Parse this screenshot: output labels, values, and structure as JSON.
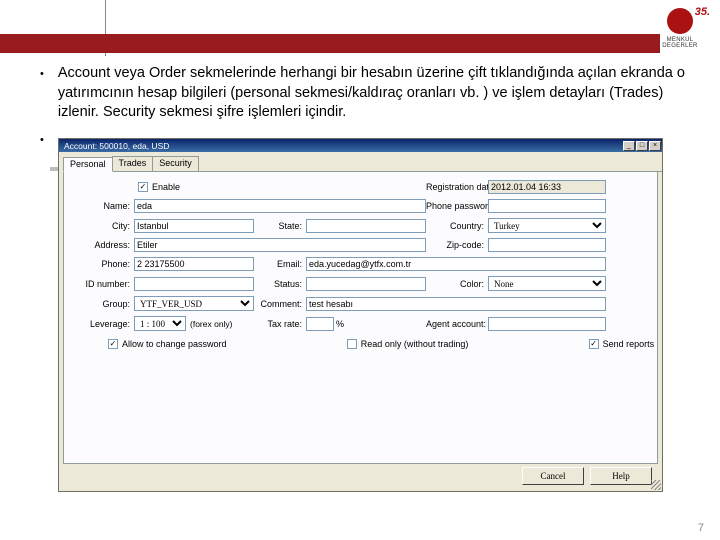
{
  "logo": {
    "years": "35.",
    "brand": "MENKUL DEGERLER"
  },
  "slide": {
    "bullet_text": "Account veya Order sekmelerinde herhangi bir hesabın üzerine çift tıklandığında açılan ekranda o yatırımcının hesap bilgileri (personal sekmesi/kaldıraç oranları vb. ) ve işlem detayları (Trades) izlenir. Security sekmesi şifre işlemleri içindir."
  },
  "dialog": {
    "title": "Account: 500010, eda, USD",
    "tabs": [
      "Personal",
      "Trades",
      "Security"
    ],
    "active_tab": 0,
    "enable_label": "Enable",
    "enable_checked": true,
    "labels": {
      "name": "Name:",
      "city": "City:",
      "address": "Address:",
      "phone": "Phone:",
      "id": "ID number:",
      "group": "Group:",
      "leverage": "Leverage:",
      "regdate": "Registration date:",
      "phonepw": "Phone password:",
      "state": "State:",
      "country": "Country:",
      "zip": "Zip-code:",
      "email": "Email:",
      "status": "Status:",
      "color": "Color:",
      "comment": "Comment:",
      "taxrate": "Tax rate:",
      "agent": "Agent account:"
    },
    "values": {
      "name": "eda",
      "city": "Istanbul",
      "address": "Etiler",
      "phone": "2 23175500",
      "id": "",
      "group": "YTF_VER_USD",
      "leverage": "1 : 100",
      "regdate": "2012.01.04 16:33",
      "phonepw": "",
      "state": "",
      "country": "Turkey",
      "zip": "",
      "email": "eda.yucedag@ytfx.com.tr",
      "status": "",
      "color": "None",
      "comment": "test hesabı",
      "taxrate": "",
      "agent": ""
    },
    "forex_only": "(forex only)",
    "percent": "%",
    "checks": {
      "allow_pw": {
        "label": "Allow to change password",
        "checked": true
      },
      "readonly": {
        "label": "Read only (without trading)",
        "checked": false
      },
      "reports": {
        "label": "Send reports",
        "checked": true
      }
    },
    "buttons": {
      "cancel": "Cancel",
      "help": "Help"
    }
  },
  "page_number": "7"
}
